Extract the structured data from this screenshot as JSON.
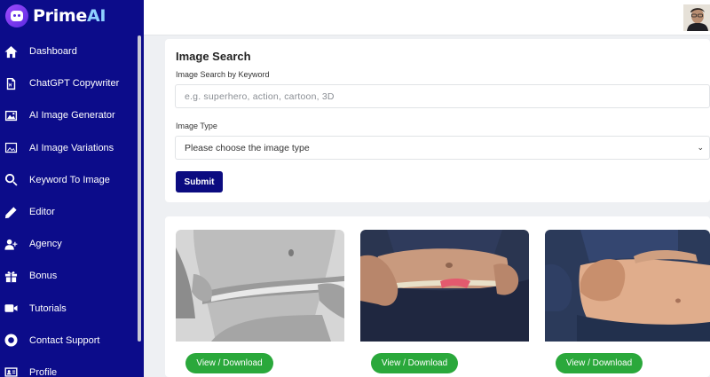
{
  "brand": {
    "name_main": "Prime",
    "name_accent": "AI"
  },
  "sidebar": {
    "items": [
      {
        "label": "Dashboard",
        "icon": "home-icon"
      },
      {
        "label": "ChatGPT Copywriter",
        "icon": "document-w-icon"
      },
      {
        "label": "AI Image Generator",
        "icon": "image-icon"
      },
      {
        "label": "AI Image Variations",
        "icon": "image-outline-icon"
      },
      {
        "label": "Keyword To Image",
        "icon": "search-icon"
      },
      {
        "label": "Editor",
        "icon": "pencil-icon"
      },
      {
        "label": "Agency",
        "icon": "user-plus-icon"
      },
      {
        "label": "Bonus",
        "icon": "gift-icon"
      },
      {
        "label": "Tutorials",
        "icon": "video-icon"
      },
      {
        "label": "Contact Support",
        "icon": "lifebuoy-icon"
      },
      {
        "label": "Profile",
        "icon": "id-card-icon"
      }
    ]
  },
  "search": {
    "title": "Image Search",
    "keyword_label": "Image Search by Keyword",
    "keyword_value": "",
    "keyword_placeholder": "e.g. superhero, action, cartoon, 3D",
    "type_label": "Image Type",
    "type_selected": "Please choose the image type",
    "submit_label": "Submit"
  },
  "results": {
    "button_label": "View / Download",
    "items": [
      {
        "image": "belly-measuring-tape-bw"
      },
      {
        "image": "belly-measuring-tape-color"
      },
      {
        "image": "belly-hand-pinch"
      }
    ]
  },
  "colors": {
    "sidebar": "#0c0c8a",
    "submit": "#0b0b80",
    "download": "#2aa83b"
  }
}
